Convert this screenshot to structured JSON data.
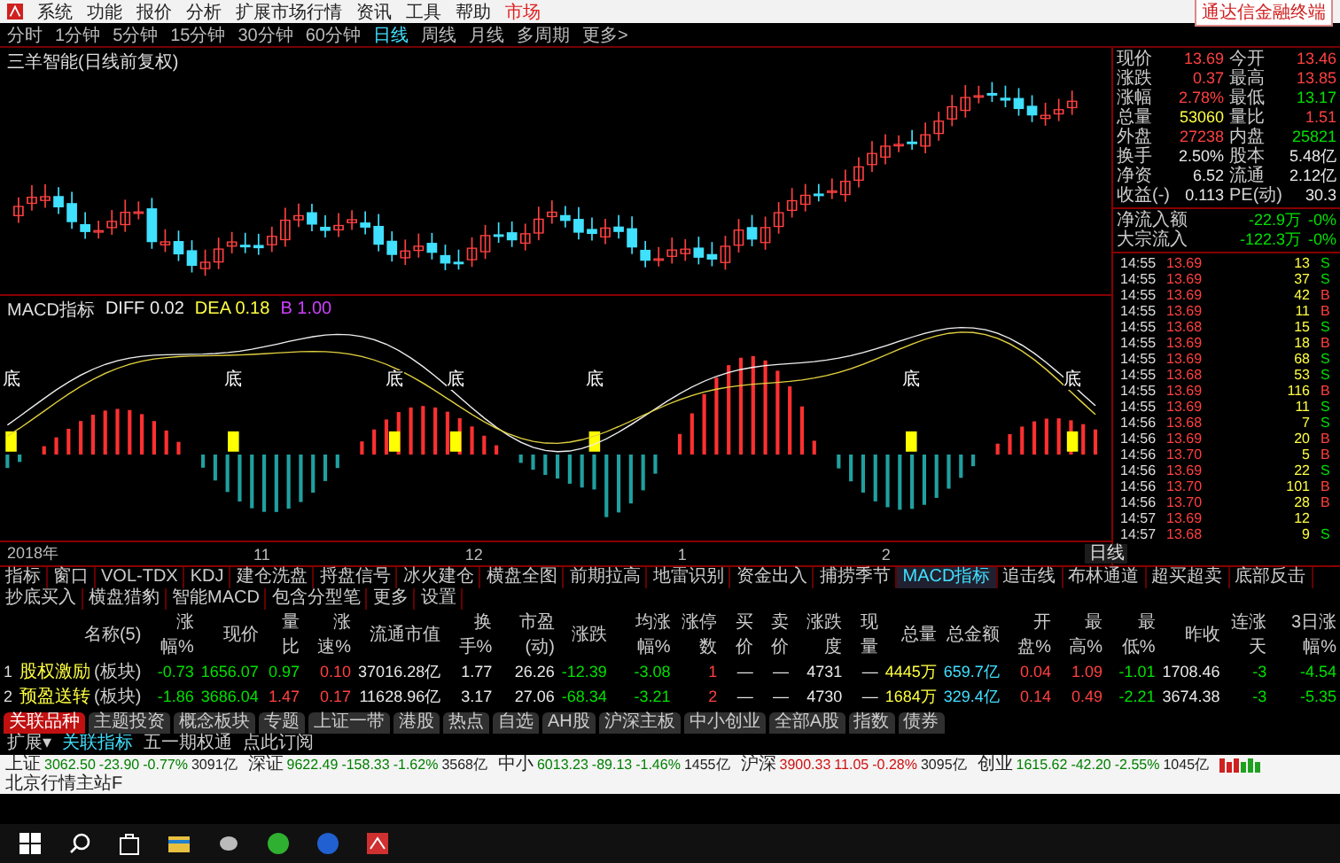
{
  "menu": [
    {
      "label": "系统",
      "selected": false
    },
    {
      "label": "功能",
      "selected": false
    },
    {
      "label": "报价",
      "selected": false
    },
    {
      "label": "分析",
      "selected": false
    },
    {
      "label": "扩展市场行情",
      "selected": false
    },
    {
      "label": "资讯",
      "selected": false
    },
    {
      "label": "工具",
      "selected": false
    },
    {
      "label": "帮助",
      "selected": false
    },
    {
      "label": "市场",
      "selected": true
    }
  ],
  "app_title": "通达信金融终端",
  "periods": [
    {
      "label": "分时",
      "selected": false
    },
    {
      "label": "1分钟",
      "selected": false
    },
    {
      "label": "5分钟",
      "selected": false
    },
    {
      "label": "15分钟",
      "selected": false
    },
    {
      "label": "30分钟",
      "selected": false
    },
    {
      "label": "60分钟",
      "selected": false
    },
    {
      "label": "日线",
      "selected": true
    },
    {
      "label": "周线",
      "selected": false
    },
    {
      "label": "月线",
      "selected": false
    },
    {
      "label": "多周期",
      "selected": false
    },
    {
      "label": "更多>",
      "selected": false
    }
  ],
  "chart_title": "三羊智能(日线前复权)",
  "macd": {
    "name": "MACD指标",
    "diff": "DIFF 0.02",
    "dea": "DEA 0.18",
    "extra": "B 1.00",
    "signal_labels": [
      "底",
      "底",
      "底",
      "底",
      "底",
      "底",
      "底"
    ]
  },
  "date_axis": [
    "2018年",
    "11",
    "12",
    "1",
    "2"
  ],
  "period_badge": "日线",
  "quote": [
    {
      "label": "现价",
      "value": "13.69",
      "color": "#ff4040"
    },
    {
      "label": "今开",
      "value": "13.46",
      "color": "#ff4040"
    },
    {
      "label": "涨跌",
      "value": "0.37",
      "color": "#ff4040"
    },
    {
      "label": "最高",
      "value": "13.85",
      "color": "#ff4040"
    },
    {
      "label": "涨幅",
      "value": "2.78%",
      "color": "#ff4040"
    },
    {
      "label": "最低",
      "value": "13.17",
      "color": "#00e000"
    },
    {
      "label": "总量",
      "value": "53060",
      "color": "#ffff40"
    },
    {
      "label": "量比",
      "value": "1.51",
      "color": "#ff4040"
    },
    {
      "label": "外盘",
      "value": "27238",
      "color": "#ff4040"
    },
    {
      "label": "内盘",
      "value": "25821",
      "color": "#00e000"
    },
    {
      "label": "换手",
      "value": "2.50%",
      "color": "#e8e8e8"
    },
    {
      "label": "股本",
      "value": "5.48亿",
      "color": "#e8e8e8"
    },
    {
      "label": "净资",
      "value": "6.52",
      "color": "#e8e8e8"
    },
    {
      "label": "流通",
      "value": "2.12亿",
      "color": "#e8e8e8"
    },
    {
      "label": "收益(-)",
      "value": "0.113",
      "color": "#e8e8e8"
    },
    {
      "label": "PE(动)",
      "value": "30.3",
      "color": "#e8e8e8"
    }
  ],
  "flows": [
    {
      "label": "净流入额",
      "value": "-22.9万",
      "pct": "-0%"
    },
    {
      "label": "大宗流入",
      "value": "-122.3万",
      "pct": "-0%"
    }
  ],
  "ticks": [
    {
      "time": "14:55",
      "price": "13.69",
      "volume": "13",
      "side": "S"
    },
    {
      "time": "14:55",
      "price": "13.69",
      "volume": "37",
      "side": "S"
    },
    {
      "time": "14:55",
      "price": "13.69",
      "volume": "42",
      "side": "B"
    },
    {
      "time": "14:55",
      "price": "13.69",
      "volume": "11",
      "side": "B"
    },
    {
      "time": "14:55",
      "price": "13.68",
      "volume": "15",
      "side": "S"
    },
    {
      "time": "14:55",
      "price": "13.69",
      "volume": "18",
      "side": "B"
    },
    {
      "time": "14:55",
      "price": "13.69",
      "volume": "68",
      "side": "S"
    },
    {
      "time": "14:55",
      "price": "13.68",
      "volume": "53",
      "side": "S"
    },
    {
      "time": "14:55",
      "price": "13.69",
      "volume": "116",
      "side": "B"
    },
    {
      "time": "14:55",
      "price": "13.69",
      "volume": "11",
      "side": "S"
    },
    {
      "time": "14:56",
      "price": "13.68",
      "volume": "7",
      "side": "S"
    },
    {
      "time": "14:56",
      "price": "13.69",
      "volume": "20",
      "side": "B"
    },
    {
      "time": "14:56",
      "price": "13.70",
      "volume": "5",
      "side": "B"
    },
    {
      "time": "14:56",
      "price": "13.69",
      "volume": "22",
      "side": "S"
    },
    {
      "time": "14:56",
      "price": "13.70",
      "volume": "101",
      "side": "B"
    },
    {
      "time": "14:56",
      "price": "13.70",
      "volume": "28",
      "side": "B"
    },
    {
      "time": "14:57",
      "price": "13.69",
      "volume": "12"
    },
    {
      "time": "14:57",
      "price": "13.68",
      "volume": "9",
      "side": "S"
    }
  ],
  "indicator_tabs": [
    {
      "label": "指标",
      "selected": false
    },
    {
      "label": "窗口",
      "selected": false
    },
    {
      "label": "VOL-TDX",
      "selected": false
    },
    {
      "label": "KDJ",
      "selected": false
    },
    {
      "label": "建仓洗盘",
      "selected": false
    },
    {
      "label": "捋盘信号",
      "selected": false
    },
    {
      "label": "冰火建仓",
      "selected": false
    },
    {
      "label": "横盘全图",
      "selected": false
    },
    {
      "label": "前期拉高",
      "selected": false
    },
    {
      "label": "地雷识别",
      "selected": false
    },
    {
      "label": "资金出入",
      "selected": false
    },
    {
      "label": "捕捞季节",
      "selected": false
    },
    {
      "label": "MACD指标",
      "selected": true
    },
    {
      "label": "追击线",
      "selected": false
    },
    {
      "label": "布林通道",
      "selected": false
    },
    {
      "label": "超买超卖",
      "selected": false
    },
    {
      "label": "底部反击",
      "selected": false
    },
    {
      "label": "抄底买入",
      "selected": false
    },
    {
      "label": "横盘猎豹",
      "selected": false
    },
    {
      "label": "智能MACD",
      "selected": false
    },
    {
      "label": "包含分型笔",
      "selected": false
    },
    {
      "label": "更多",
      "selected": false
    },
    {
      "label": "设置",
      "selected": false
    }
  ],
  "table": {
    "columns": [
      "名称(5)",
      "涨幅%",
      "现价",
      "量比",
      "涨速%",
      "流通市值",
      "换手%",
      "市盈(动)",
      "涨跌",
      "均涨幅%",
      "涨停数",
      "买价",
      "卖价",
      "涨跌度",
      "现量",
      "总量",
      "总金额",
      "开盘%",
      "最高%",
      "最低%",
      "昨收",
      "连涨天",
      "3日涨幅%"
    ],
    "rows": [
      {
        "index": "1",
        "cells": [
          {
            "v": "股权激励",
            "tag": "(板块)",
            "color": "#ffff40"
          },
          {
            "v": "-0.73",
            "color": "#00e000"
          },
          {
            "v": "1656.07",
            "color": "#00e000"
          },
          {
            "v": "0.97",
            "color": "#00e000"
          },
          {
            "v": "0.10",
            "color": "#ff4040"
          },
          {
            "v": "37016.28亿",
            "color": "#e8e8e8"
          },
          {
            "v": "1.77",
            "color": "#e8e8e8"
          },
          {
            "v": "26.26",
            "color": "#e8e8e8"
          },
          {
            "v": "-12.39",
            "color": "#00e000"
          },
          {
            "v": "-3.08",
            "color": "#00e000"
          },
          {
            "v": "1",
            "color": "#ff4040"
          },
          {
            "v": "—",
            "color": "#e8e8e8"
          },
          {
            "v": "—",
            "color": "#e8e8e8"
          },
          {
            "v": "4731",
            "color": "#e8e8e8"
          },
          {
            "v": "—",
            "color": "#e8e8e8"
          },
          {
            "v": "4445万",
            "color": "#ffff40"
          },
          {
            "v": "659.7亿",
            "color": "#40e0ff"
          },
          {
            "v": "0.04",
            "color": "#ff4040"
          },
          {
            "v": "1.09",
            "color": "#ff4040"
          },
          {
            "v": "-1.01",
            "color": "#00e000"
          },
          {
            "v": "1708.46",
            "color": "#e8e8e8"
          },
          {
            "v": "-3",
            "color": "#00e000"
          },
          {
            "v": "-4.54",
            "color": "#00e000"
          }
        ]
      },
      {
        "index": "2",
        "cells": [
          {
            "v": "预盈送转",
            "tag": "(板块)",
            "color": "#ffff40"
          },
          {
            "v": "-1.86",
            "color": "#00e000"
          },
          {
            "v": "3686.04",
            "color": "#00e000"
          },
          {
            "v": "1.47",
            "color": "#ff4040"
          },
          {
            "v": "0.17",
            "color": "#ff4040"
          },
          {
            "v": "11628.96亿",
            "color": "#e8e8e8"
          },
          {
            "v": "3.17",
            "color": "#e8e8e8"
          },
          {
            "v": "27.06",
            "color": "#e8e8e8"
          },
          {
            "v": "-68.34",
            "color": "#00e000"
          },
          {
            "v": "-3.21",
            "color": "#00e000"
          },
          {
            "v": "2",
            "color": "#ff4040"
          },
          {
            "v": "—",
            "color": "#e8e8e8"
          },
          {
            "v": "—",
            "color": "#e8e8e8"
          },
          {
            "v": "4730",
            "color": "#e8e8e8"
          },
          {
            "v": "—",
            "color": "#e8e8e8"
          },
          {
            "v": "1684万",
            "color": "#ffff40"
          },
          {
            "v": "329.4亿",
            "color": "#40e0ff"
          },
          {
            "v": "0.14",
            "color": "#ff4040"
          },
          {
            "v": "0.49",
            "color": "#ff4040"
          },
          {
            "v": "-2.21",
            "color": "#00e000"
          },
          {
            "v": "3674.38",
            "color": "#e8e8e8"
          },
          {
            "v": "-3",
            "color": "#00e000"
          },
          {
            "v": "-5.35",
            "color": "#00e000"
          }
        ]
      }
    ]
  },
  "bottom_tabs": [
    {
      "label": "关联品种",
      "selected": true
    },
    {
      "label": "主题投资",
      "selected": false
    },
    {
      "label": "概念板块",
      "selected": false
    },
    {
      "label": "专题",
      "selected": false
    },
    {
      "label": "上证一带",
      "selected": false
    },
    {
      "label": "港股",
      "selected": false
    },
    {
      "label": "热点",
      "selected": false
    },
    {
      "label": "自选",
      "selected": false
    },
    {
      "label": "AH股",
      "selected": false
    },
    {
      "label": "沪深主板",
      "selected": false
    },
    {
      "label": "中小创业",
      "selected": false
    },
    {
      "label": "全部A股",
      "selected": false
    },
    {
      "label": "指数",
      "selected": false
    },
    {
      "label": "债券",
      "selected": false
    }
  ],
  "links": [
    "扩展▾",
    "关联指标",
    "五一期权通",
    "点此订阅"
  ],
  "status_bar": {
    "indices": [
      {
        "name": "上证",
        "value": "3062.50",
        "change": "-23.90",
        "pct": "-0.77%",
        "amount": "3091亿",
        "color": "#008000"
      },
      {
        "name": "深证",
        "value": "9622.49",
        "change": "-158.33",
        "pct": "-1.62%",
        "amount": "3568亿",
        "color": "#008000"
      },
      {
        "name": "中小",
        "value": "6013.23",
        "change": "-89.13",
        "pct": "-1.46%",
        "amount": "1455亿",
        "color": "#008000"
      },
      {
        "name": "沪深",
        "value": "3900.33",
        "change": "11.05",
        "pct": "-0.28%",
        "amount": "3095亿",
        "color": "#d01010"
      },
      {
        "name": "创业",
        "value": "1615.62",
        "change": "-42.20",
        "pct": "-2.55%",
        "amount": "1045亿",
        "color": "#008000"
      }
    ],
    "server": "北京行情主站F"
  }
}
